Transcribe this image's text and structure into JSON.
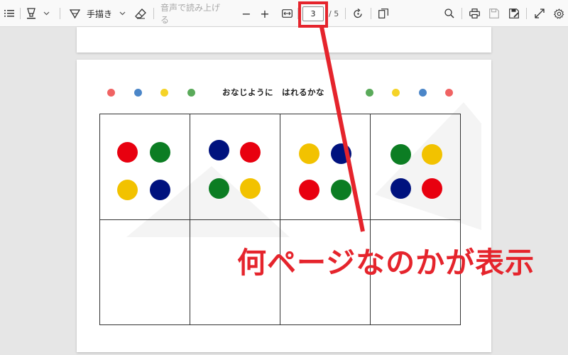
{
  "toolbar": {
    "draw_label": "手描き",
    "read_aloud_label": "音声で読み上げる",
    "zoom_out": "−",
    "zoom_in": "+",
    "current_page": "3",
    "page_total": "/ 5"
  },
  "document": {
    "title": "おなじように　はれるかな",
    "colors": {
      "red": "#e8000f",
      "blue": "#00127e",
      "green": "#0c7d23",
      "yellow": "#f2c200",
      "small_red": "#f06363",
      "small_blue": "#4b86c8",
      "small_yellow": "#f5d327",
      "small_green": "#5aaa5a"
    }
  },
  "annotation": {
    "text": "何ページなのかが表示",
    "color": "#e5242c"
  }
}
